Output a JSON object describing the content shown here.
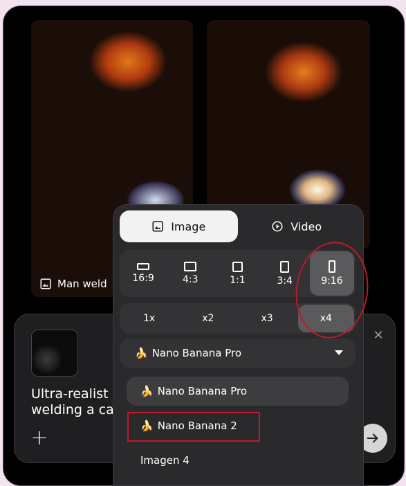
{
  "gallery": {
    "left_caption": "Man weld"
  },
  "composer": {
    "prompt_text_line1": "Ultra-realist",
    "prompt_text_line2": "welding a ca",
    "plus_icon": "plus-icon",
    "close_icon": "close-icon",
    "send_icon": "arrow-right-icon"
  },
  "mode_tabs": {
    "image_label": "Image",
    "video_label": "Video",
    "active": "Image"
  },
  "aspect_ratios": {
    "items": [
      "16:9",
      "4:3",
      "1:1",
      "3:4",
      "9:16"
    ],
    "selected": "9:16"
  },
  "scale_options": {
    "items": [
      "1x",
      "x2",
      "x3",
      "x4"
    ],
    "selected": "x4"
  },
  "model": {
    "selected_label": "Nano Banana Pro",
    "options": [
      "Nano Banana Pro",
      "Nano Banana 2",
      "Imagen 4"
    ]
  },
  "emoji": {
    "banana": "🍌"
  },
  "colors": {
    "annotation_red": "#c2182a",
    "panel_bg": "#2a2a2c",
    "active_tab_bg": "#f2f2f2"
  }
}
